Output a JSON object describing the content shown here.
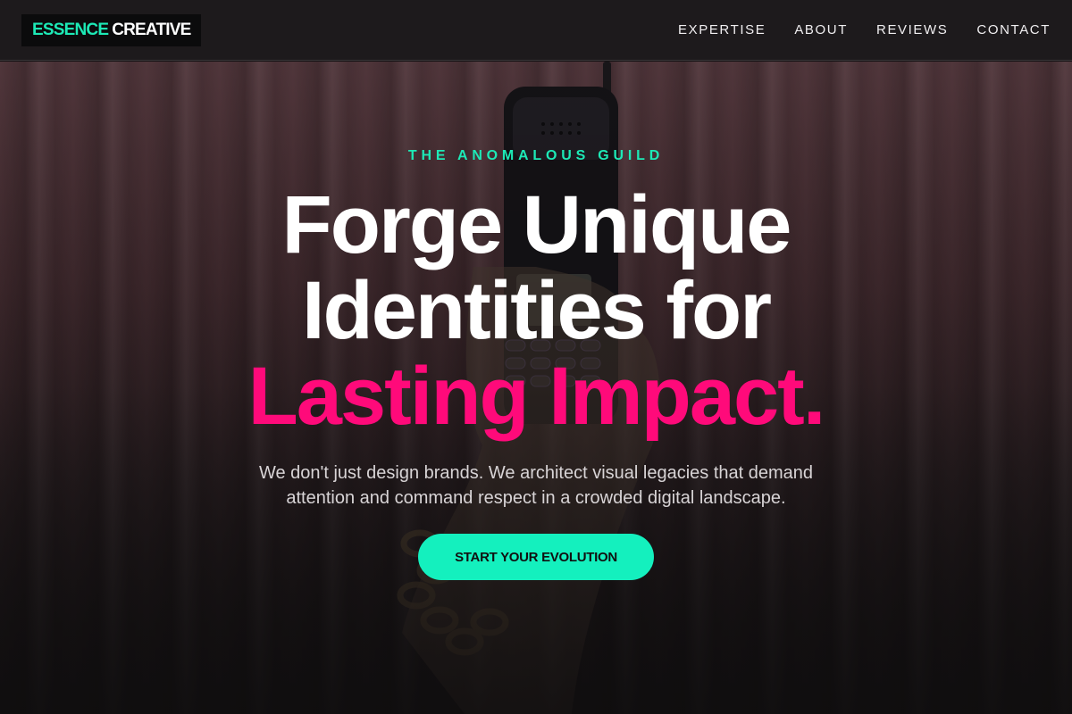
{
  "header": {
    "logo": {
      "part1": "ESSENCE",
      "part2": "CREATIVE"
    },
    "nav": [
      {
        "label": "EXPERTISE"
      },
      {
        "label": "ABOUT"
      },
      {
        "label": "REVIEWS"
      },
      {
        "label": "CONTACT"
      }
    ]
  },
  "hero": {
    "eyebrow": "THE ANOMALOUS GUILD",
    "headline": {
      "line1": "Forge Unique",
      "line2": "Identities for",
      "line3": "Lasting Impact."
    },
    "subtext": "We don't just design brands. We architect visual legacies that demand attention and command respect in a crowded digital landscape.",
    "cta_label": "START YOUR EVOLUTION"
  },
  "colors": {
    "accent_teal": "#1de9b6",
    "accent_pink": "#ff0a7a",
    "cta_background": "#14f0be"
  }
}
